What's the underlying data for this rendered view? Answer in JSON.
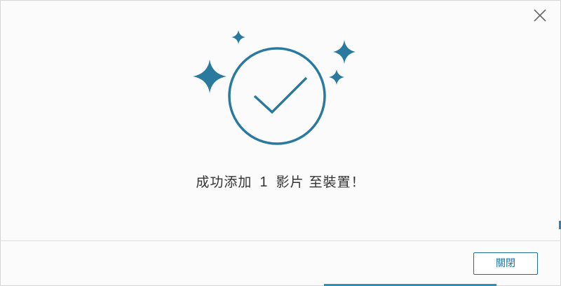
{
  "dialog": {
    "message_prefix": "成功添加",
    "count": "1",
    "message_middle": "影片",
    "message_suffix": "至裝置！",
    "close_button_label": "關閉"
  },
  "icons": {
    "close": "close-icon",
    "success": "success-check-icon",
    "sparkles": "sparkle-icon"
  },
  "colors": {
    "accent": "#2a7aa0",
    "button_border": "#1e6f96",
    "text": "#333333"
  }
}
